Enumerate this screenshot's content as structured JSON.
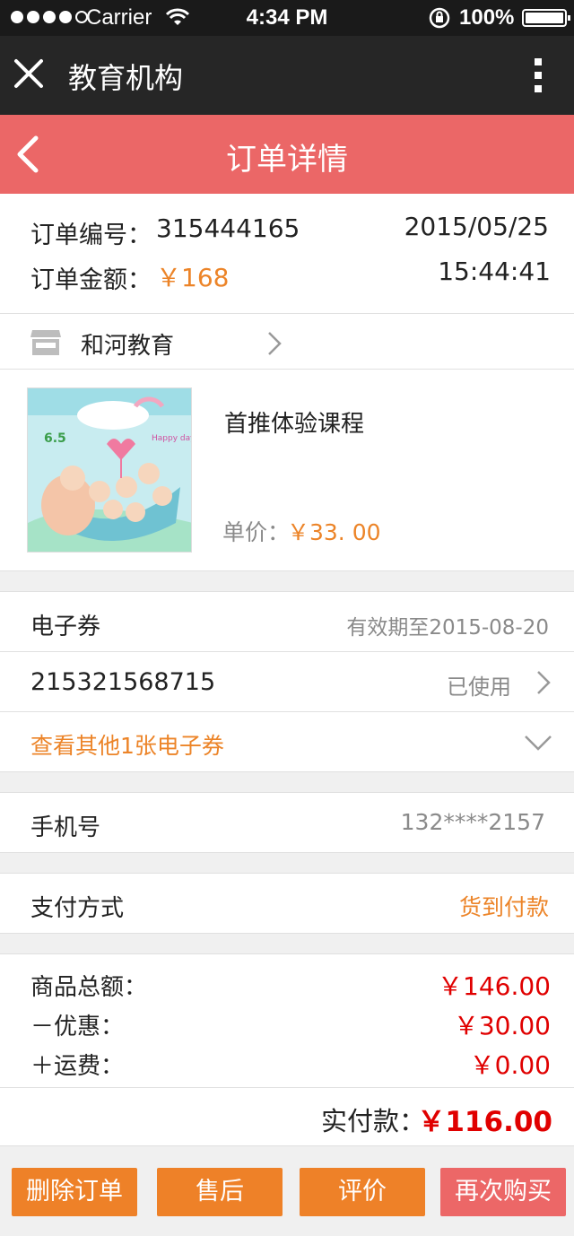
{
  "status_bar": {
    "carrier": "Carrier",
    "time": "4:34 PM",
    "battery_pct": "100%"
  },
  "app_bar": {
    "title": "教育机构",
    "close_icon": "close-icon",
    "more_icon": "more-vertical-icon"
  },
  "nav_bar": {
    "title": "订单详情",
    "back_icon": "back-icon"
  },
  "order": {
    "number_label": "订单编号：",
    "number": "315444165",
    "amount_label": "订单金额：",
    "amount": "￥168",
    "date": "2015/05/25",
    "time": "15:44:41"
  },
  "store": {
    "name": "和河教育",
    "icon": "store-icon"
  },
  "product": {
    "name": "首推体验课程",
    "unit_price_label": "单价：",
    "unit_price": "￥33. 00",
    "image_badge": "6.5",
    "image_tag": "Happy day"
  },
  "voucher": {
    "label": "电子券",
    "validity": "有效期至2015-08-20",
    "code": "215321568715",
    "status": "已使用",
    "more_link": "查看其他1张电子券"
  },
  "phone": {
    "label": "手机号",
    "value": "132****2157"
  },
  "payment": {
    "label": "支付方式",
    "value": "货到付款"
  },
  "summary": {
    "goods_total_label": "商品总额：",
    "goods_total": "￥146.00",
    "discount_label": "－优惠：",
    "discount": "￥30.00",
    "shipping_label": "＋运费：",
    "shipping": "￥0.00",
    "paid_label": "实付款：",
    "paid": "￥116.00"
  },
  "actions": {
    "delete": "删除订单",
    "after_sale": "售后",
    "review": "评价",
    "rebuy": "再次购买"
  },
  "colors": {
    "accent_orange": "#ec8428",
    "price_red": "#e00000",
    "nav_pink": "#eb6767",
    "app_bar_dark": "#262626"
  }
}
